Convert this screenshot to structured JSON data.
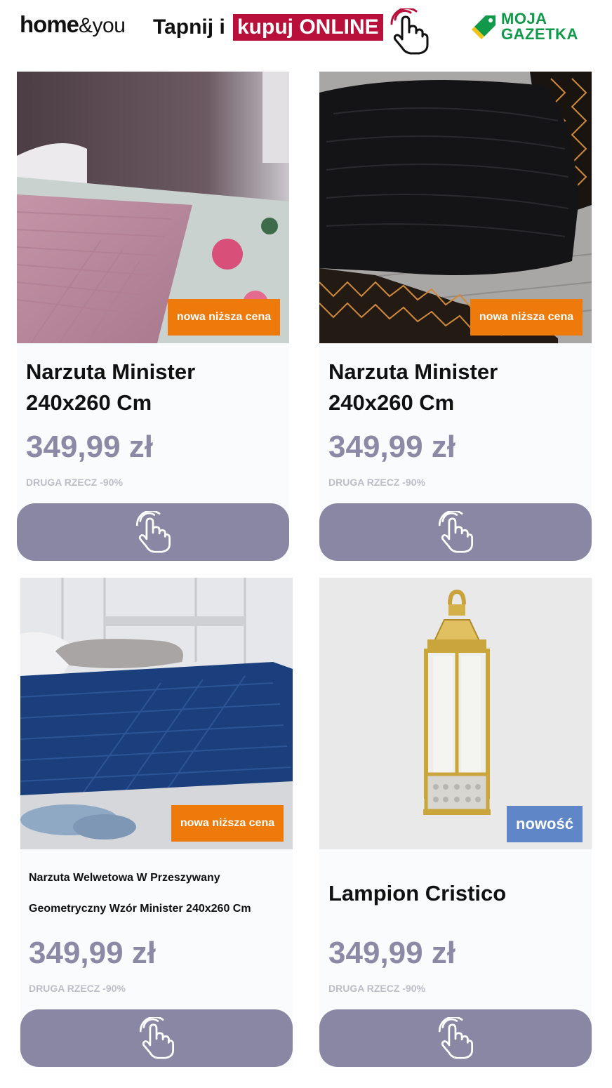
{
  "header": {
    "brand_home": "home",
    "brand_rest": "&you",
    "tap_text": "Tapnij i",
    "tap_highlight": "kupuj ONLINE",
    "moja_line1": "MOJA",
    "moja_line2": "GAZETKA"
  },
  "products": [
    {
      "badge": "nowa niższa cena",
      "title_line1": "Narzuta Minister",
      "title_line2": "240x260 Cm",
      "price": "349,99 zł",
      "promo": "DRUGA RZECZ -90%",
      "image": "pink-quilted-bedspread"
    },
    {
      "badge": "nowa niższa cena",
      "title_line1": "Narzuta Minister",
      "title_line2": "240x260 Cm",
      "price": "349,99 zł",
      "promo": "DRUGA RZECZ -90%",
      "image": "black-quilted-bedspread"
    },
    {
      "badge": "nowa niższa cena",
      "title_line1": "Narzuta Welwetowa W Przeszywany",
      "title_line2": "Geometryczny Wzór Minister 240x260 Cm",
      "price": "349,99 zł",
      "promo": "DRUGA RZECZ -90%",
      "image": "navy-velvet-bedspread"
    },
    {
      "badge": "nowość",
      "title_line1": "Lampion Cristico",
      "price": "349,99 zł",
      "promo": "DRUGA RZECZ -90%",
      "image": "gold-lantern"
    }
  ],
  "colors": {
    "brand_red": "#b8103b",
    "badge_orange": "#ee7a0c",
    "badge_blue": "#5f86c6",
    "button": "#8a87a5",
    "price": "#8b8aa6",
    "moja_green": "#11994a"
  },
  "icons": {
    "button_icon": "hand-pointer-icon"
  }
}
